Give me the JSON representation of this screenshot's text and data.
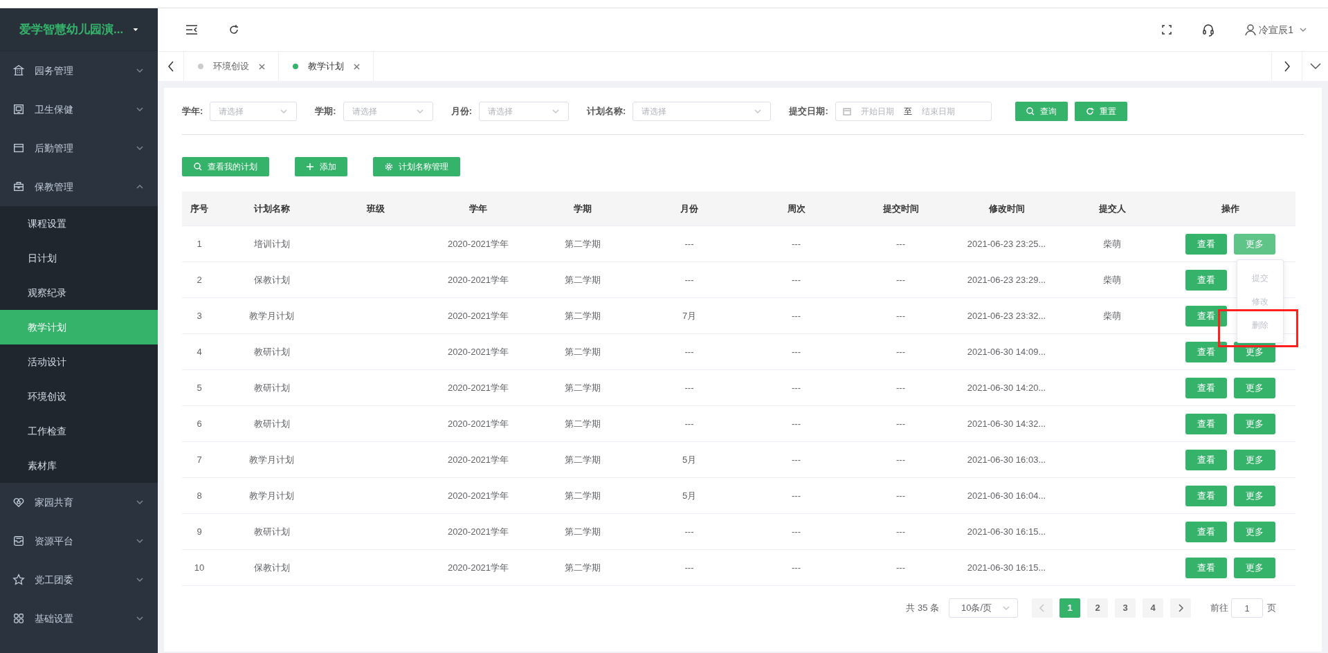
{
  "sidebar": {
    "title": "爱学智慧幼儿园演...",
    "items": [
      {
        "label": "园务管理",
        "expanded": false
      },
      {
        "label": "卫生保健",
        "expanded": false
      },
      {
        "label": "后勤管理",
        "expanded": false
      },
      {
        "label": "保教管理",
        "expanded": true,
        "children": [
          {
            "label": "课程设置",
            "selected": false
          },
          {
            "label": "日计划",
            "selected": false
          },
          {
            "label": "观察纪录",
            "selected": false
          },
          {
            "label": "教学计划",
            "selected": true
          },
          {
            "label": "活动设计",
            "selected": false
          },
          {
            "label": "环境创设",
            "selected": false
          },
          {
            "label": "工作检查",
            "selected": false
          },
          {
            "label": "素材库",
            "selected": false
          }
        ]
      },
      {
        "label": "家园共育",
        "expanded": false
      },
      {
        "label": "资源平台",
        "expanded": false
      },
      {
        "label": "党工团委",
        "expanded": false
      },
      {
        "label": "基础设置",
        "expanded": false
      }
    ]
  },
  "header": {
    "user": "冷宣辰1"
  },
  "tabs": [
    {
      "label": "环境创设",
      "selected": false
    },
    {
      "label": "教学计划",
      "selected": true
    }
  ],
  "filters": [
    {
      "label": "学年:",
      "placeholder": "请选择"
    },
    {
      "label": "学期:",
      "placeholder": "请选择"
    },
    {
      "label": "月份:",
      "placeholder": "请选择"
    },
    {
      "label": "计划名称:",
      "placeholder": "请选择"
    }
  ],
  "date_filter": {
    "label": "提交日期:",
    "start_placeholder": "开始日期",
    "separator": "至",
    "end_placeholder": "结束日期"
  },
  "filter_buttons": [
    {
      "kind": "search",
      "label": "查询"
    },
    {
      "kind": "reset",
      "label": "重置"
    }
  ],
  "toolbar_buttons": [
    {
      "kind": "search",
      "label": "查看我的计划"
    },
    {
      "kind": "add",
      "label": "添加"
    },
    {
      "kind": "gear",
      "label": "计划名称管理"
    }
  ],
  "table": {
    "columns": [
      "序号",
      "计划名称",
      "班级",
      "学年",
      "学期",
      "月份",
      "周次",
      "提交时间",
      "修改时间",
      "提交人",
      "操作"
    ],
    "rows": [
      {
        "cells": [
          "1",
          "培训计划",
          "",
          "2020-2021学年",
          "第二学期",
          "---",
          "---",
          "---",
          "2021-06-23 23:25...",
          "柴萌"
        ],
        "actions": [
          {
            "label": "查看",
            "hovered": false
          },
          {
            "label": "更多",
            "hovered": true
          }
        ]
      },
      {
        "cells": [
          "2",
          "保教计划",
          "",
          "2020-2021学年",
          "第二学期",
          "---",
          "---",
          "---",
          "2021-06-23 23:29...",
          "柴萌"
        ],
        "actions": [
          {
            "label": "查看",
            "hovered": false
          }
        ]
      },
      {
        "cells": [
          "3",
          "教学月计划",
          "",
          "2020-2021学年",
          "第二学期",
          "7月",
          "---",
          "---",
          "2021-06-23 23:32...",
          "柴萌"
        ],
        "actions": [
          {
            "label": "查看",
            "hovered": false
          }
        ]
      },
      {
        "cells": [
          "4",
          "教研计划",
          "",
          "2020-2021学年",
          "第二学期",
          "---",
          "---",
          "---",
          "2021-06-30 14:09...",
          ""
        ],
        "actions": [
          {
            "label": "查看",
            "hovered": false
          },
          {
            "label": "更多",
            "hovered": false
          }
        ]
      },
      {
        "cells": [
          "5",
          "教研计划",
          "",
          "2020-2021学年",
          "第二学期",
          "---",
          "---",
          "---",
          "2021-06-30 14:20...",
          ""
        ],
        "actions": [
          {
            "label": "查看",
            "hovered": false
          },
          {
            "label": "更多",
            "hovered": false
          }
        ]
      },
      {
        "cells": [
          "6",
          "教研计划",
          "",
          "2020-2021学年",
          "第二学期",
          "---",
          "---",
          "---",
          "2021-06-30 14:32...",
          ""
        ],
        "actions": [
          {
            "label": "查看",
            "hovered": false
          },
          {
            "label": "更多",
            "hovered": false
          }
        ]
      },
      {
        "cells": [
          "7",
          "教学月计划",
          "",
          "2020-2021学年",
          "第二学期",
          "5月",
          "---",
          "---",
          "2021-06-30 16:03...",
          ""
        ],
        "actions": [
          {
            "label": "查看",
            "hovered": false
          },
          {
            "label": "更多",
            "hovered": false
          }
        ]
      },
      {
        "cells": [
          "8",
          "教学月计划",
          "",
          "2020-2021学年",
          "第二学期",
          "5月",
          "---",
          "---",
          "2021-06-30 16:04...",
          ""
        ],
        "actions": [
          {
            "label": "查看",
            "hovered": false
          },
          {
            "label": "更多",
            "hovered": false
          }
        ]
      },
      {
        "cells": [
          "9",
          "教研计划",
          "",
          "2020-2021学年",
          "第二学期",
          "---",
          "---",
          "---",
          "2021-06-30 16:15...",
          ""
        ],
        "actions": [
          {
            "label": "查看",
            "hovered": false
          },
          {
            "label": "更多",
            "hovered": false
          }
        ]
      },
      {
        "cells": [
          "10",
          "保教计划",
          "",
          "2020-2021学年",
          "第二学期",
          "---",
          "---",
          "---",
          "2021-06-30 16:15...",
          ""
        ],
        "actions": [
          {
            "label": "查看",
            "hovered": false
          },
          {
            "label": "更多",
            "hovered": false
          }
        ]
      }
    ]
  },
  "more_menu": {
    "items": [
      {
        "label": "提交",
        "disabled": true
      },
      {
        "label": "修改",
        "disabled": true
      },
      {
        "label": "删除",
        "disabled": true
      }
    ]
  },
  "pagination": {
    "total": "共 35 条",
    "page_size": "10条/页",
    "pages": [
      {
        "label": "1",
        "selected": true
      },
      {
        "label": "2",
        "selected": false
      },
      {
        "label": "3",
        "selected": false
      },
      {
        "label": "4",
        "selected": false
      }
    ],
    "goto_label": "前往",
    "goto_value": "1",
    "goto_suffix": "页"
  }
}
